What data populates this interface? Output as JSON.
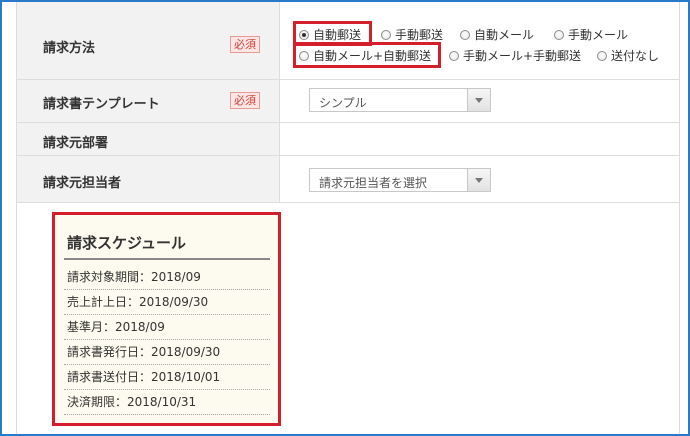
{
  "form": {
    "billing_method": {
      "label": "請求方法",
      "required": "必須",
      "options": [
        "自動郵送",
        "手動郵送",
        "自動メール",
        "手動メール",
        "自動メール+自動郵送",
        "手動メール+手動郵送",
        "送付なし"
      ],
      "selected": "自動郵送"
    },
    "template": {
      "label": "請求書テンプレート",
      "required": "必須",
      "value": "シンプル"
    },
    "department": {
      "label": "請求元部署"
    },
    "person": {
      "label": "請求元担当者",
      "placeholder": "請求元担当者を選択"
    }
  },
  "schedule": {
    "title": "請求スケジュール",
    "items": [
      "請求対象期間：2018/09",
      "売上計上日：2018/09/30",
      "基準月：2018/09",
      "請求書発行日：2018/09/30",
      "請求書送付日：2018/10/01",
      "決済期限：2018/10/31"
    ]
  },
  "colors": {
    "highlight": "#d51e2b",
    "frame": "#2b79c9",
    "required": "#d0413a"
  }
}
